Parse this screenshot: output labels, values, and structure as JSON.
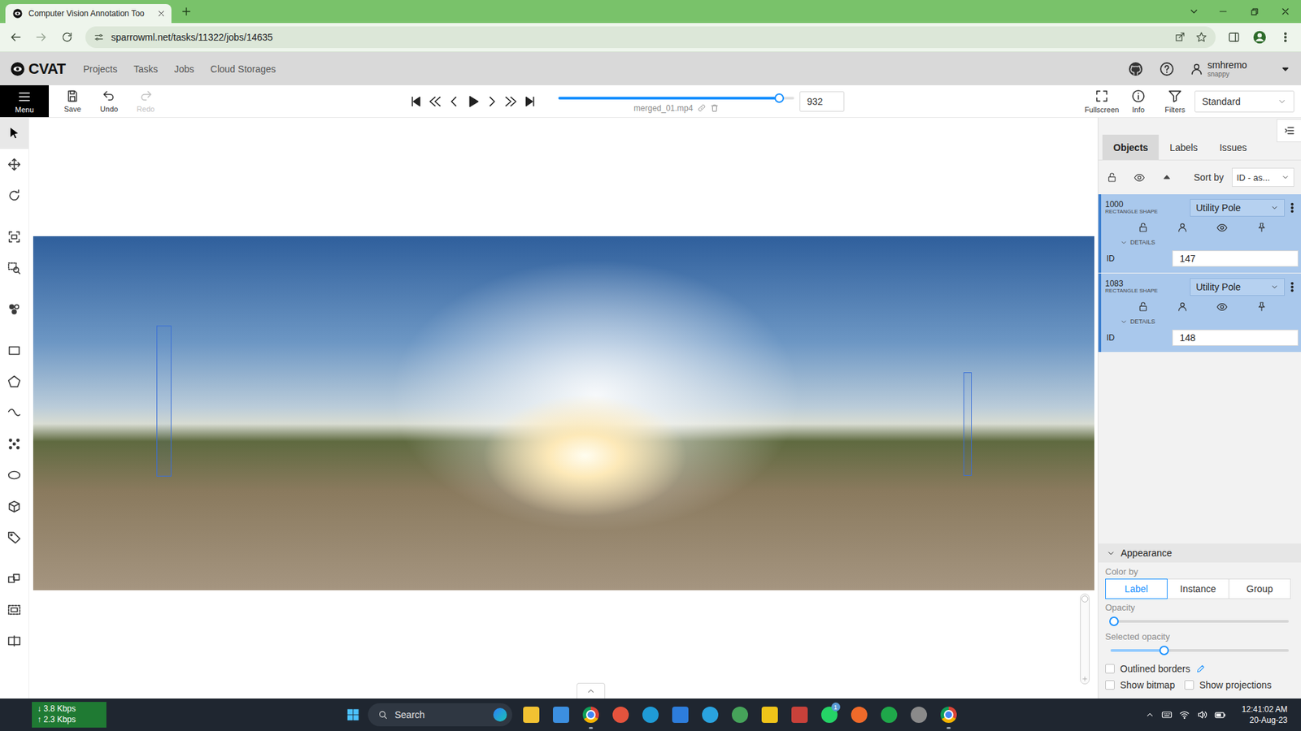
{
  "browser": {
    "tab_title": "Computer Vision Annotation Too",
    "url": "sparrowml.net/tasks/11322/jobs/14635"
  },
  "header": {
    "logo": "CVAT",
    "nav": [
      {
        "label": "Projects",
        "selected": false
      },
      {
        "label": "Tasks",
        "selected": false
      },
      {
        "label": "Jobs",
        "selected": false
      },
      {
        "label": "Cloud Storages",
        "selected": false
      }
    ],
    "user": {
      "name": "smhremo",
      "org": "snappy"
    }
  },
  "toolbar": {
    "menu": "Menu",
    "actions": [
      {
        "label": "Save",
        "kind": "save",
        "disabled": false
      },
      {
        "label": "Undo",
        "kind": "undo",
        "disabled": false
      },
      {
        "label": "Redo",
        "kind": "redo",
        "disabled": true
      }
    ],
    "player": {
      "level": 0.937,
      "frame": "932",
      "filename": "merged_01.mp4"
    },
    "views": [
      {
        "label": "Fullscreen",
        "kind": "fullscreen"
      },
      {
        "label": "Info",
        "kind": "info"
      },
      {
        "label": "Filters",
        "kind": "filter"
      }
    ],
    "workspace": "Standard"
  },
  "tools": [
    [
      {
        "kind": "cursor",
        "selected": true
      },
      {
        "kind": "move",
        "selected": false
      },
      {
        "kind": "rotate",
        "selected": false
      }
    ],
    [
      {
        "kind": "fit",
        "selected": false
      },
      {
        "kind": "zoom",
        "selected": false
      }
    ],
    [
      {
        "kind": "ai",
        "selected": false
      }
    ],
    [
      {
        "kind": "rect",
        "selected": false
      },
      {
        "kind": "polygon",
        "selected": false
      },
      {
        "kind": "polyline",
        "selected": false
      },
      {
        "kind": "points",
        "selected": false
      },
      {
        "kind": "ellipse",
        "selected": false
      },
      {
        "kind": "cuboid",
        "selected": false
      },
      {
        "kind": "tag",
        "selected": false
      }
    ],
    [
      {
        "kind": "merge",
        "selected": false
      },
      {
        "kind": "group",
        "selected": false
      },
      {
        "kind": "split",
        "selected": false
      }
    ]
  ],
  "sidebar": {
    "tabs": [
      {
        "label": "Objects",
        "selected": true
      },
      {
        "label": "Labels",
        "selected": false
      },
      {
        "label": "Issues",
        "selected": false
      }
    ],
    "sort_label": "Sort by",
    "sort_value": "ID - as...",
    "objects": [
      {
        "id": "1000",
        "type": "RECTANGLE SHAPE",
        "label": "Utility Pole",
        "details": "DETAILS",
        "attribute": "ID",
        "value": "147"
      },
      {
        "id": "1083",
        "type": "RECTANGLE SHAPE",
        "label": "Utility Pole",
        "details": "DETAILS",
        "attribute": "ID",
        "value": "148"
      }
    ],
    "appearance": {
      "title": "Appearance",
      "color_by_label": "Color by",
      "color_by": [
        {
          "label": "Label",
          "selected": true
        },
        {
          "label": "Instance",
          "selected": false
        },
        {
          "label": "Group",
          "selected": false
        }
      ],
      "sliders": [
        {
          "label": "Opacity",
          "level": 0.02
        },
        {
          "label": "Selected opacity",
          "level": 0.3
        }
      ],
      "checks": [
        {
          "label": "Outlined borders",
          "checked": false,
          "kind": "edit"
        },
        {
          "label": "Show bitmap",
          "checked": false,
          "kind": "plain"
        },
        {
          "label": "Show projections",
          "checked": false,
          "kind": "plain"
        }
      ]
    }
  },
  "taskbar": {
    "net_down": "↓ 3.8 Kbps",
    "net_up": "↑ 2.3 Kbps",
    "search": "Search",
    "apps": [
      {
        "kind": "square",
        "color": "#f2c232",
        "running": false
      },
      {
        "kind": "square",
        "color": "#3c8fe0",
        "running": false
      },
      {
        "kind": "chrome",
        "color": "#db4437",
        "running": true
      },
      {
        "kind": "circle",
        "color": "#e5533d",
        "running": false
      },
      {
        "kind": "circle",
        "color": "#1f9bd6",
        "running": false
      },
      {
        "kind": "square",
        "color": "#2d7ddc",
        "running": false
      },
      {
        "kind": "circle",
        "color": "#2aa3df",
        "running": false
      },
      {
        "kind": "circle",
        "color": "#46a35a",
        "running": false
      },
      {
        "kind": "square",
        "color": "#f0c419",
        "running": false
      },
      {
        "kind": "square",
        "color": "#c8413a",
        "running": false
      },
      {
        "kind": "circle",
        "color": "#25d366",
        "running": false,
        "badge": "1"
      },
      {
        "kind": "circle",
        "color": "#ef6a2a",
        "running": false
      },
      {
        "kind": "circle",
        "color": "#1fa84a",
        "running": false
      },
      {
        "kind": "circle",
        "color": "#8a8a8a",
        "running": false
      },
      {
        "kind": "chrome",
        "color": "#db4437",
        "running": true
      }
    ],
    "time": "12:41:02 AM",
    "date": "20-Aug-23"
  }
}
